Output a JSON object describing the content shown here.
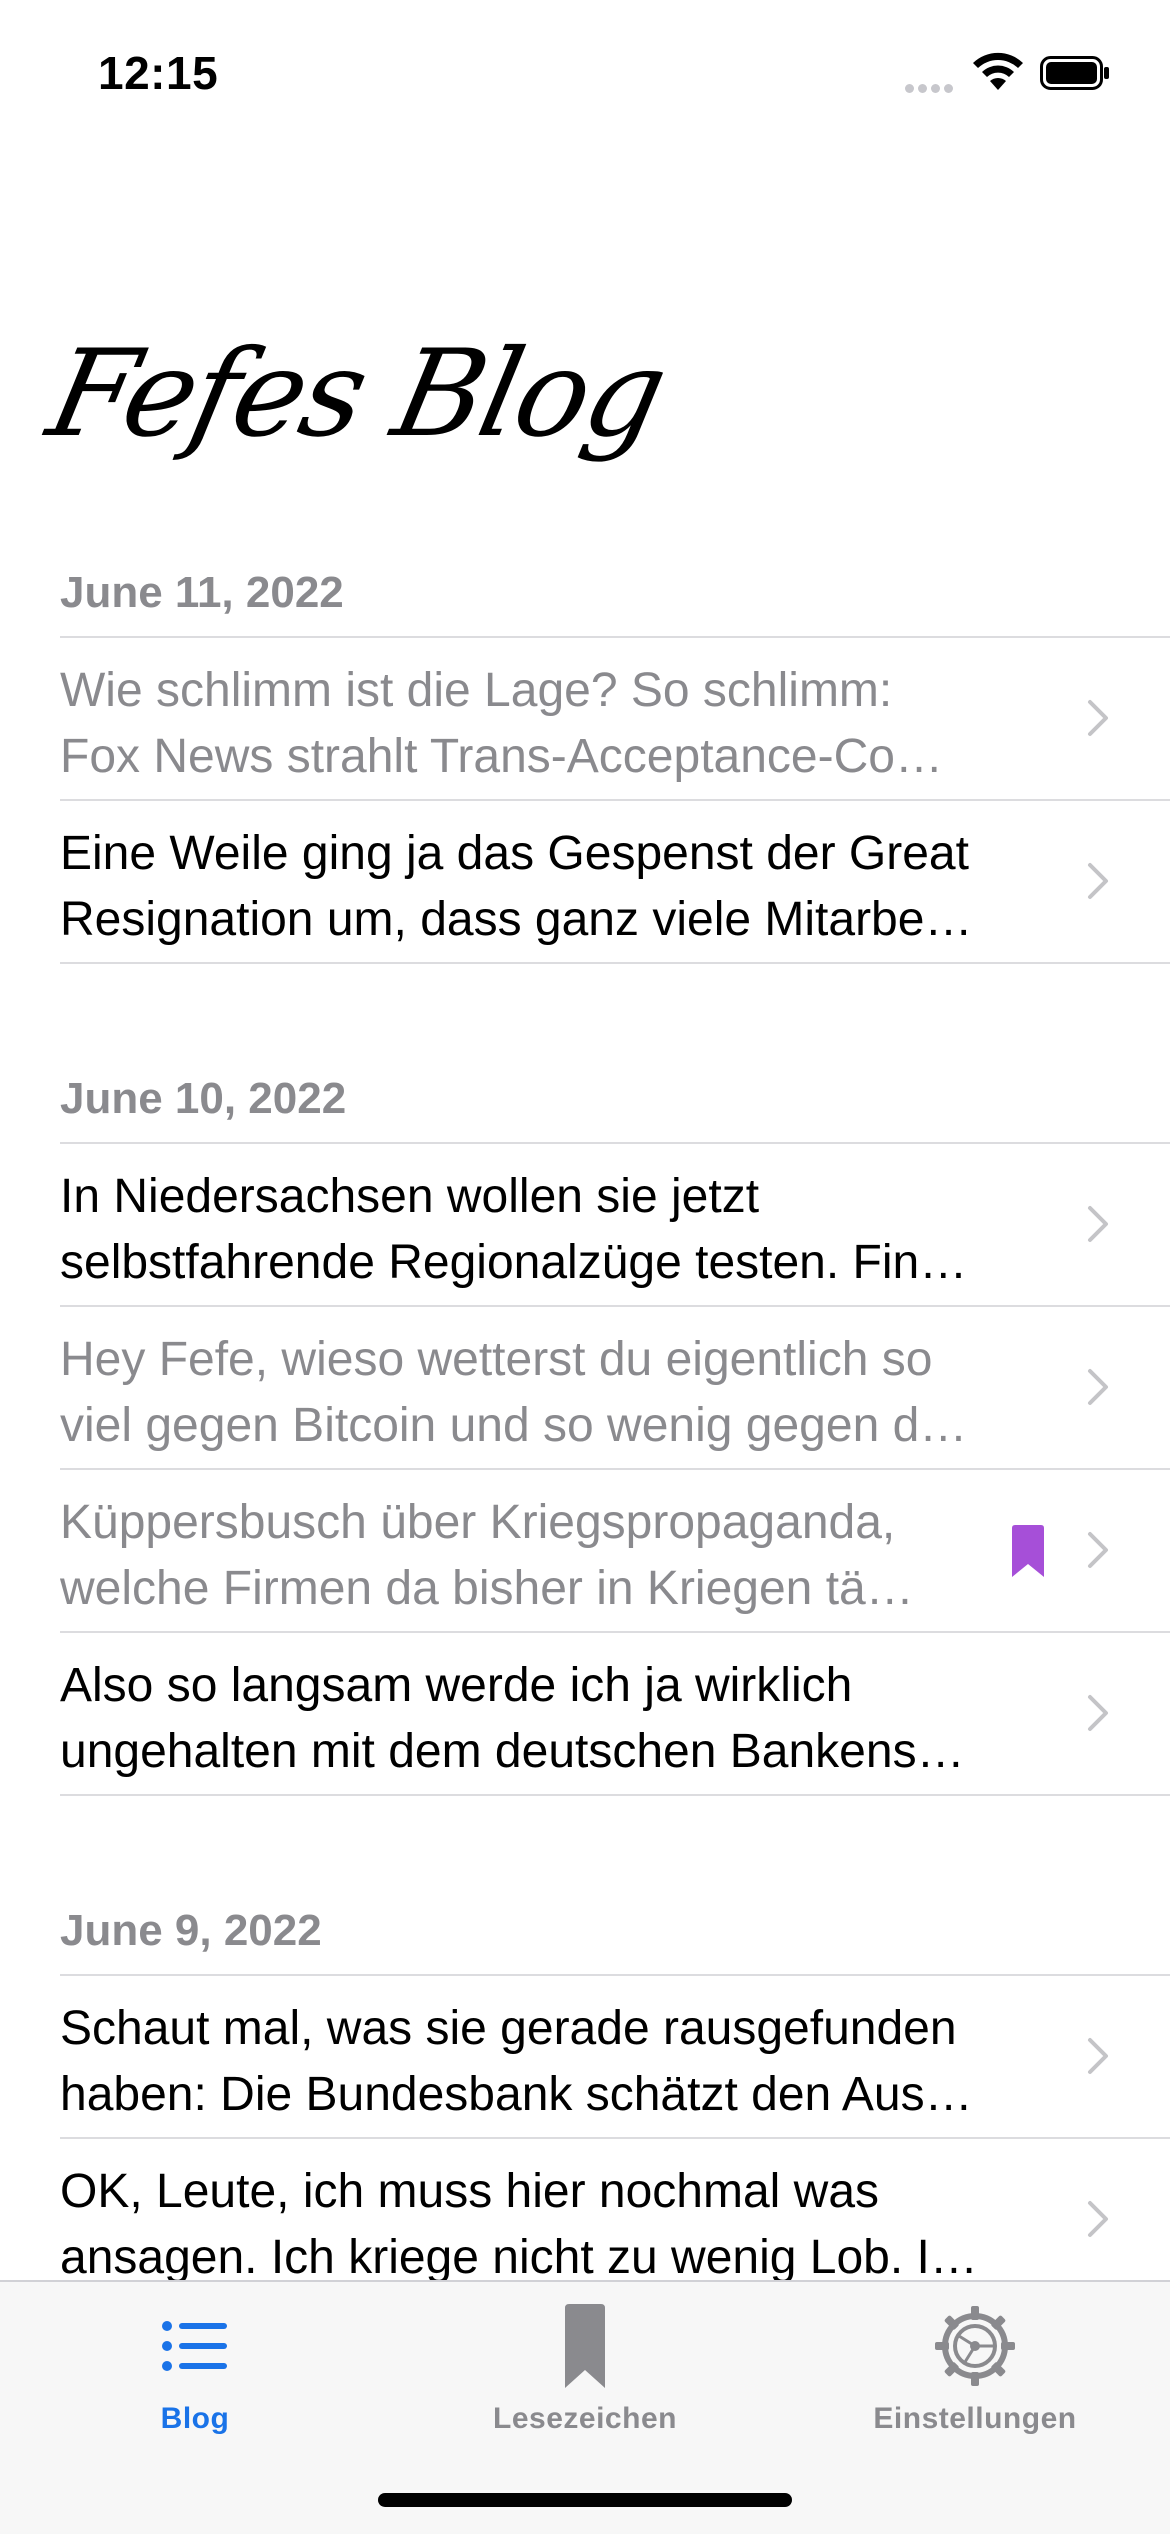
{
  "status": {
    "time": "12:15"
  },
  "app": {
    "title": "Fefes Blog"
  },
  "sections": [
    {
      "date": "June 11, 2022",
      "rows": [
        {
          "line1": "Wie schlimm ist die Lage? So schlimm:",
          "line2": "Fox News strahlt Trans-Acceptance-Co…",
          "read": true,
          "bookmarked": false
        },
        {
          "line1": "Eine Weile ging ja das Gespenst der Great",
          "line2": "Resignation um, dass ganz viele Mitarbe…",
          "read": false,
          "bookmarked": false
        }
      ]
    },
    {
      "date": "June 10, 2022",
      "rows": [
        {
          "line1": "In Niedersachsen wollen sie jetzt",
          "line2": "selbstfahrende Regionalzüge testen. Fin…",
          "read": false,
          "bookmarked": false
        },
        {
          "line1": "Hey Fefe, wieso wetterst du eigentlich so",
          "line2": "viel gegen Bitcoin und so wenig gegen d…",
          "read": true,
          "bookmarked": false
        },
        {
          "line1": "Küppersbusch über Kriegspropaganda,",
          "line2": "welche Firmen da bisher in Kriegen tä…",
          "read": true,
          "bookmarked": true
        },
        {
          "line1": "Also so langsam werde ich ja wirklich",
          "line2": "ungehalten mit dem deutschen Bankens…",
          "read": false,
          "bookmarked": false
        }
      ]
    },
    {
      "date": "June 9, 2022",
      "rows": [
        {
          "line1": "Schaut mal, was sie gerade rausgefunden",
          "line2": "haben: Die Bundesbank schätzt den Aus…",
          "read": false,
          "bookmarked": false
        },
        {
          "line1": "OK, Leute, ich muss hier nochmal was",
          "line2": "ansagen. Ich kriege nicht zu wenig Lob. I…",
          "read": false,
          "bookmarked": false
        }
      ]
    }
  ],
  "tabs": [
    {
      "label": "Blog",
      "icon": "list-icon",
      "active": true
    },
    {
      "label": "Lesezeichen",
      "icon": "bookmark-icon",
      "active": false
    },
    {
      "label": "Einstellungen",
      "icon": "gear-icon",
      "active": false
    }
  ],
  "colors": {
    "accent": "#1a73e8",
    "bookmark": "#a64fd8",
    "secondary": "#8a8a8e"
  }
}
